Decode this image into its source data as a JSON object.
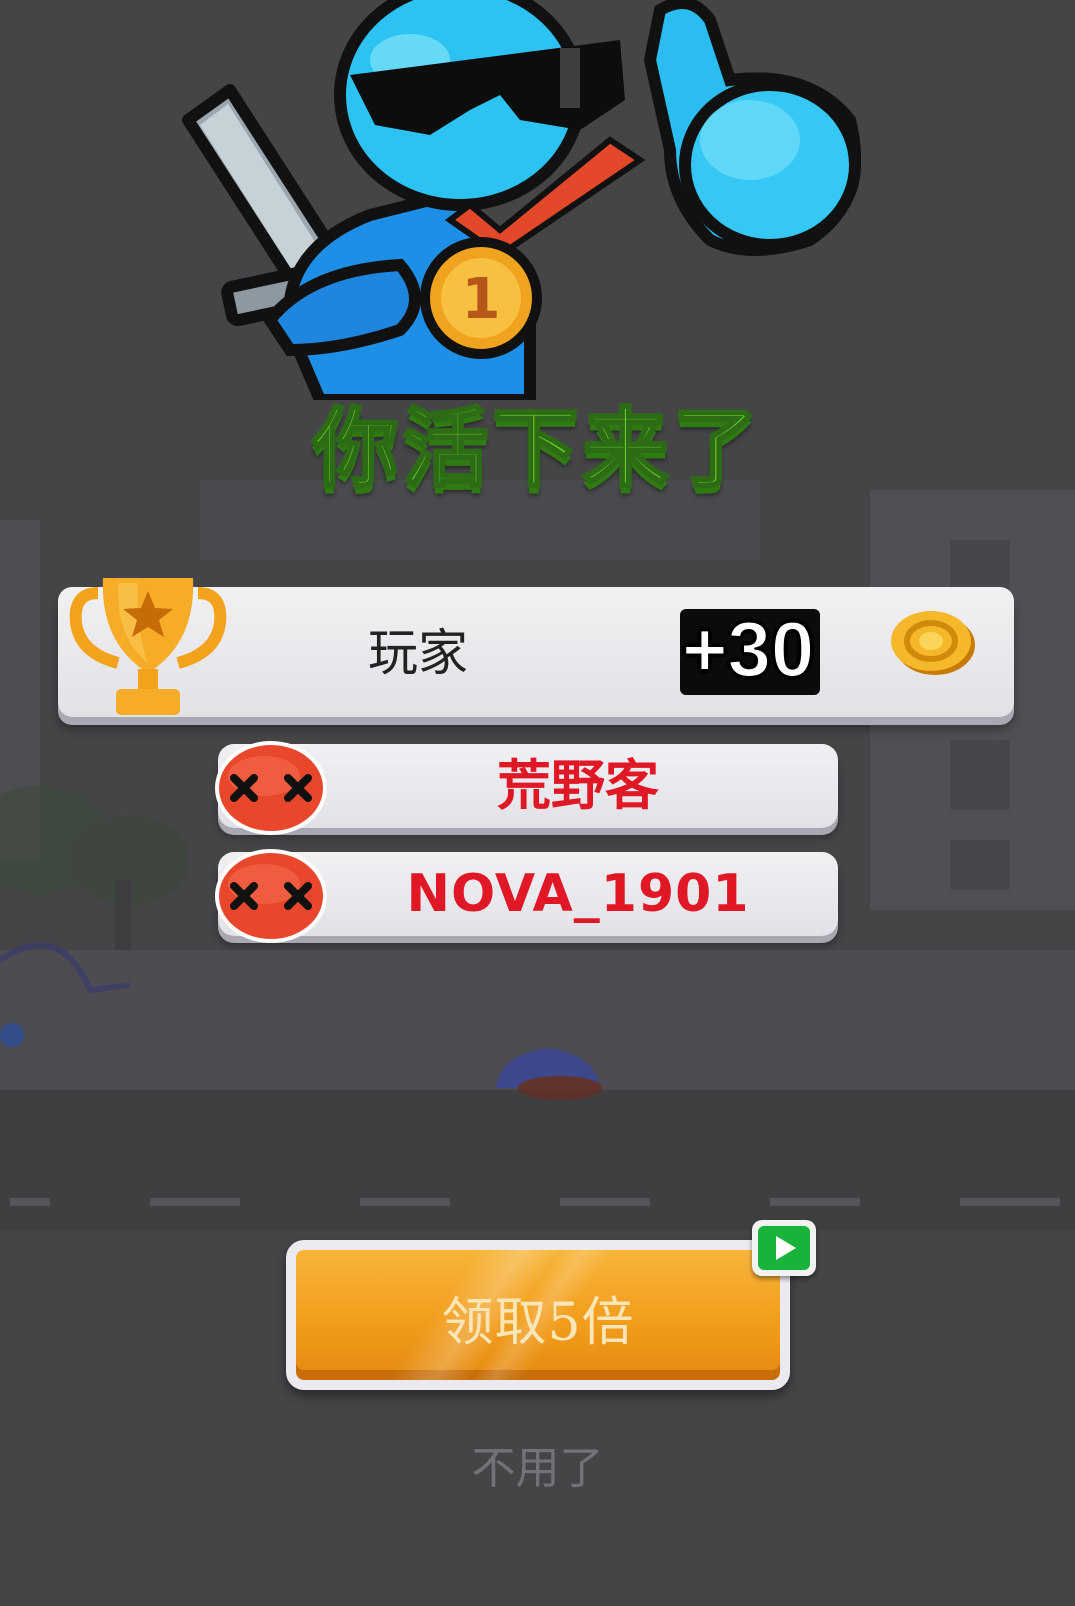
{
  "result": {
    "title": "你活下来了"
  },
  "player": {
    "name": "玩家",
    "reward": "+30"
  },
  "defeated": [
    {
      "name": "荒野客"
    },
    {
      "name": "NOVA_1901"
    }
  ],
  "actions": {
    "claim_label": "领取5倍",
    "skip_label": "不用了"
  },
  "colors": {
    "title_green": "#6ccb2b",
    "enemy_red": "#e01826",
    "claim_orange": "#f29d1c",
    "hero_blue": "#1fa8ef",
    "background": "#454548"
  }
}
